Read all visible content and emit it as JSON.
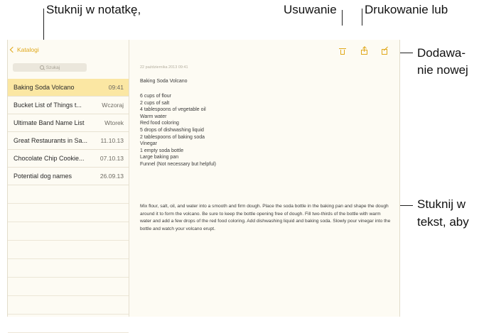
{
  "callouts": {
    "tap_note": "Stuknij w notatkę,",
    "delete": "Usuwanie",
    "print": "Drukowanie lub",
    "add_new_1": "Dodawa-",
    "add_new_2": "nie nowej",
    "tap_text_1": "Stuknij w",
    "tap_text_2": "tekst, aby"
  },
  "sidebar": {
    "back_label": "Katalogi",
    "search_placeholder": "Szukaj",
    "items": [
      {
        "title": "Baking Soda Volcano",
        "date": "09:41",
        "selected": true
      },
      {
        "title": "Bucket List of Things t...",
        "date": "Wczoraj"
      },
      {
        "title": "Ultimate Band Name List",
        "date": "Wtorek"
      },
      {
        "title": "Great Restaurants in Sa...",
        "date": "11.10.13"
      },
      {
        "title": "Chocolate Chip Cookie...",
        "date": "07.10.13"
      },
      {
        "title": "Potential dog names",
        "date": "26.09.13"
      }
    ]
  },
  "toolbar": {
    "icons": [
      "trash-icon",
      "share-icon",
      "compose-icon"
    ],
    "accent_color": "#e0a81a"
  },
  "note": {
    "date": "22 października 2013 09:41",
    "title": "Baking Soda Volcano",
    "ingredients": [
      "6 cups of flour",
      "2 cups of salt",
      "4 tablespoons of vegetable oil",
      "Warm water",
      "Red food coloring",
      "5 drops of dishwashing liquid",
      "2 tablespoons of baking soda",
      "Vinegar",
      "1 empty soda bottle",
      "Large baking pan",
      "Funnel (Not necessary but helpful)"
    ],
    "instructions": "Mix flour, salt, oil, and water into a smooth and firm dough.  Place the soda bottle in the baking pan and shape the dough around it to form the volcano.  Be sure to keep the bottle opening free of dough.  Fill two-thirds of the bottle with warm water and add a few drops of the red food coloring. Add dishwashing liquid and baking soda. Slowly pour vinegar into the bottle and watch your volcano erupt."
  }
}
